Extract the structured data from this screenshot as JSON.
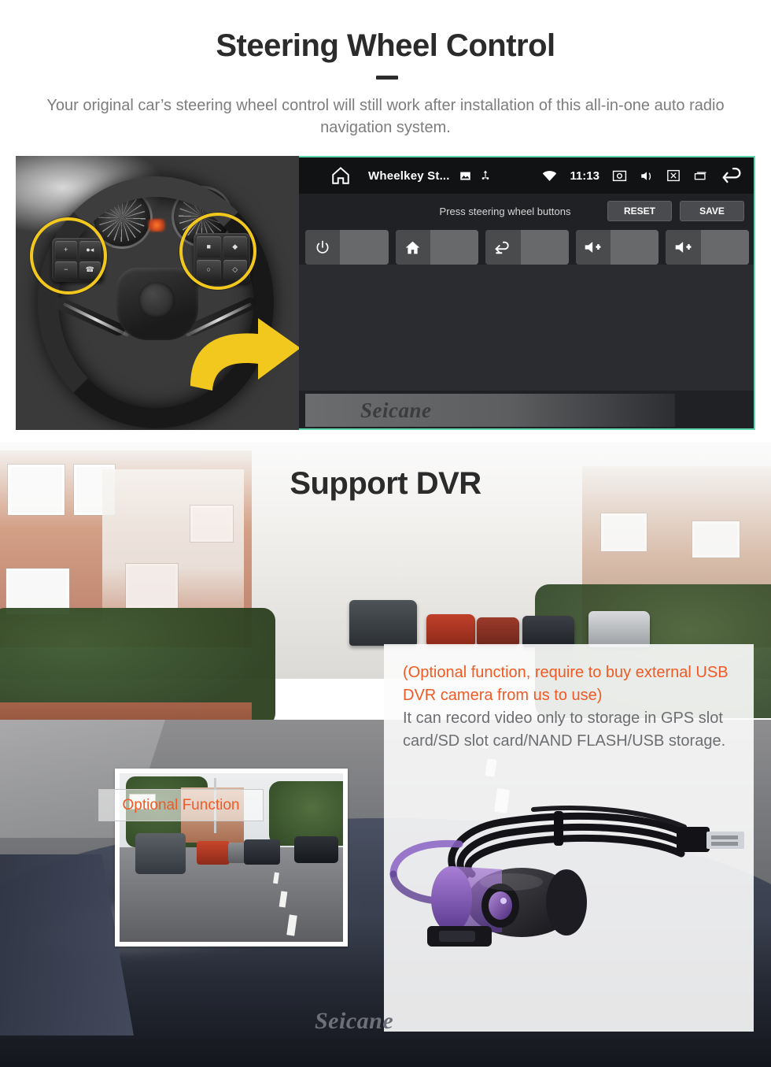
{
  "section_wheel": {
    "title": "Steering Wheel Control",
    "subtitle": "Your original car’s steering wheel control will still work after installation of this all-in-one auto radio navigation system.",
    "photo_alt": "steering-wheel-with-controls",
    "head_unit": {
      "status_bar": {
        "home_icon": "home-icon",
        "app_title": "Wheelkey St...",
        "picture_icon": "picture-icon",
        "usb_icon": "usb-icon",
        "wifi_icon": "wifi-icon",
        "clock": "11:13",
        "screenshot_icon": "screenshot-icon",
        "volume_icon": "volume-mute-icon",
        "close_icon": "close-box-icon",
        "recents_icon": "recents-icon",
        "back_icon": "back-arrow-icon"
      },
      "toolbar": {
        "hint": "Press steering wheel buttons",
        "reset_label": "RESET",
        "save_label": "SAVE"
      },
      "key_tiles": [
        {
          "icon": "power-icon",
          "value": ""
        },
        {
          "icon": "home-icon",
          "value": ""
        },
        {
          "icon": "back-icon",
          "value": ""
        },
        {
          "icon": "volume-up-icon",
          "value": ""
        },
        {
          "icon": "volume-up-icon",
          "value": ""
        }
      ],
      "watermark": "Seicane"
    }
  },
  "section_dvr": {
    "title": "Support DVR",
    "background_alt": "street-scene-from-windshield",
    "dashcam_preview_alt": "dashcam-recording-preview",
    "panel": {
      "note_orange": "(Optional function, require to buy external USB DVR camera from us to use)",
      "note_gray": "It can record video only to storage in GPS slot card/SD slot card/NAND FLASH/USB storage.",
      "camera_alt": "usb-dvr-camera-with-cable",
      "button_label": "Optional Function"
    },
    "watermark": "Seicane"
  },
  "colors": {
    "title_dark": "#2b2b2b",
    "body_gray": "#7d7d7d",
    "accent_orange": "#f15a24",
    "highlight_yellow": "#f2c81e",
    "screen_teal": "#5fd6b0",
    "head_unit_bg": "#1f2124"
  }
}
